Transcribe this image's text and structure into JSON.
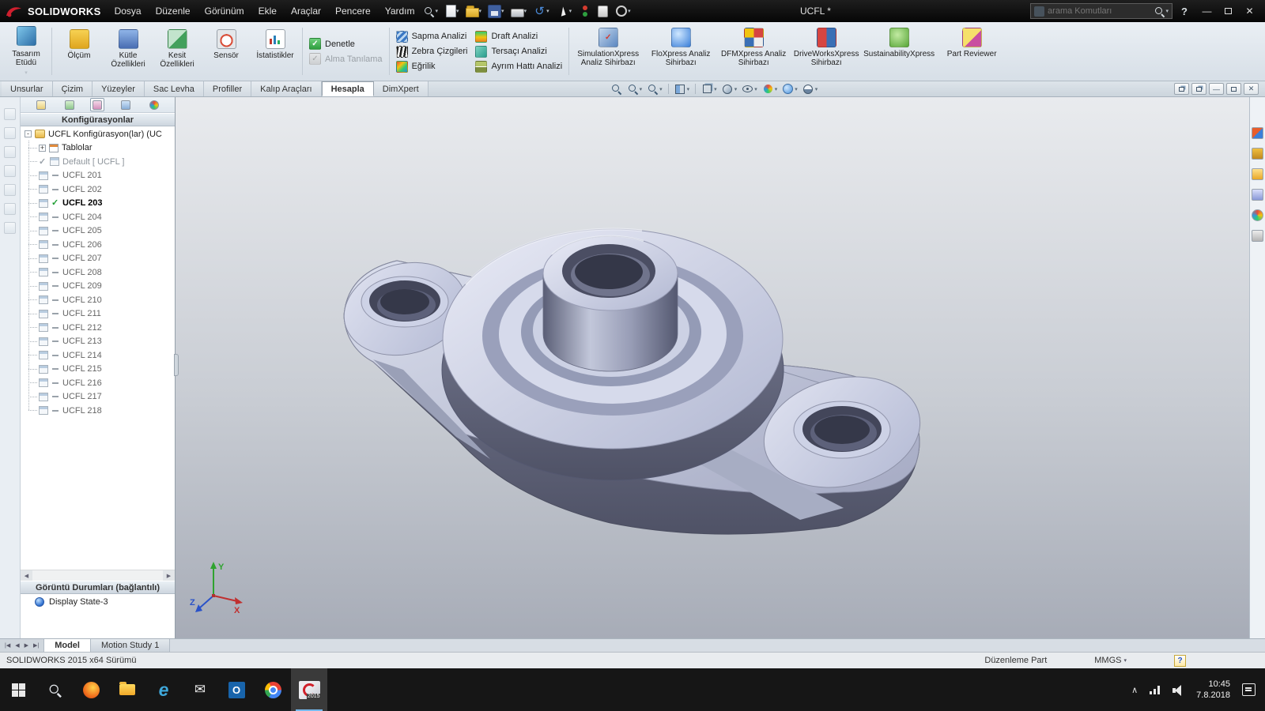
{
  "titlebar": {
    "brand": "SOLIDWORKS",
    "menus": [
      "Dosya",
      "Düzenle",
      "Görünüm",
      "Ekle",
      "Araçlar",
      "Pencere",
      "Yardım"
    ],
    "doc_title": "UCFL *",
    "search_placeholder": "arama Komutları",
    "quick_tools": [
      {
        "name": "new-document",
        "icon": "new-doc-icon",
        "caret": true
      },
      {
        "name": "open",
        "icon": "open-icon",
        "caret": true
      },
      {
        "name": "save",
        "icon": "save-icon",
        "caret": true
      },
      {
        "name": "print",
        "icon": "print-icon",
        "caret": true
      },
      {
        "name": "undo",
        "icon": "undo-icon",
        "caret": true
      },
      {
        "name": "select",
        "icon": "select-icon",
        "caret": true
      },
      {
        "name": "rebuild",
        "icon": "rebuild-icon",
        "caret": false
      },
      {
        "name": "file-properties",
        "icon": "file-properties-icon",
        "caret": false
      },
      {
        "name": "options",
        "icon": "options-icon",
        "caret": true
      }
    ]
  },
  "ribbon": {
    "design_study": {
      "label": "Tasarım Etüdü",
      "icon": "design-study-icon"
    },
    "evaluate_tools": [
      {
        "label": "Ölçüm",
        "icon": "measure-icon"
      },
      {
        "label": "Kütle Özellikleri",
        "icon": "mass-properties-icon"
      },
      {
        "label": "Kesit Özellikleri",
        "icon": "section-properties-icon"
      },
      {
        "label": "Sensör",
        "icon": "sensor-icon"
      },
      {
        "label": "İstatistikler",
        "icon": "statistics-icon"
      }
    ],
    "check_tools": [
      {
        "label": "Denetle",
        "icon": "check-icon",
        "enabled": true
      },
      {
        "label": "Alma Tanılama",
        "icon": "import-diagnostics-icon",
        "enabled": false
      }
    ],
    "analysis_col1": [
      {
        "label": "Sapma Analizi",
        "icon": "deviation-analysis-icon"
      },
      {
        "label": "Zebra Çizgileri",
        "icon": "zebra-stripes-icon"
      },
      {
        "label": "Eğrilik",
        "icon": "curvature-icon"
      }
    ],
    "analysis_col2": [
      {
        "label": "Draft Analizi",
        "icon": "draft-analysis-icon"
      },
      {
        "label": "Tersaçı Analizi",
        "icon": "undercut-analysis-icon"
      },
      {
        "label": "Ayrım Hattı Analizi",
        "icon": "parting-line-analysis-icon"
      }
    ],
    "xpress_tools": [
      {
        "label": "SimulationXpress Analiz Sihirbazı",
        "icon": "simulationxpress-icon"
      },
      {
        "label": "FloXpress Analiz Sihirbazı",
        "icon": "floxpress-icon"
      },
      {
        "label": "DFMXpress Analiz Sihirbazı",
        "icon": "dfmxpress-icon"
      },
      {
        "label": "DriveWorksXpress Sihirbazı",
        "icon": "driveworksxpress-icon"
      },
      {
        "label": "SustainabilityXpress",
        "icon": "sustainabilityxpress-icon"
      },
      {
        "label": "Part Reviewer",
        "icon": "part-reviewer-icon"
      }
    ]
  },
  "command_tabs": {
    "items": [
      "Unsurlar",
      "Çizim",
      "Yüzeyler",
      "Sac Levha",
      "Profiller",
      "Kalıp Araçları",
      "Hesapla",
      "DimXpert"
    ],
    "active": "Hesapla"
  },
  "headsup": [
    {
      "name": "zoom-fit",
      "type": "mag",
      "caret": false
    },
    {
      "name": "zoom-area",
      "type": "mag",
      "caret": true
    },
    {
      "name": "previous-view",
      "type": "mag",
      "caret": true
    },
    {
      "name": "section-view",
      "type": "css",
      "caret": true
    },
    {
      "name": "view-orientation",
      "type": "css",
      "caret": true
    },
    {
      "name": "display-style",
      "type": "css",
      "caret": true
    },
    {
      "name": "hide-show-items",
      "type": "css",
      "caret": true
    },
    {
      "name": "edit-appearance",
      "type": "css",
      "caret": true
    },
    {
      "name": "apply-scene",
      "type": "css",
      "caret": true
    },
    {
      "name": "view-settings",
      "type": "css",
      "caret": true
    }
  ],
  "feature_panel": {
    "header": "Konfigürasyonlar",
    "tree": {
      "root": "UCFL Konfigürasyon(lar)  (UC",
      "tables": "Tablolar",
      "default_config": "Default [ UCFL ]",
      "configs": [
        "UCFL 201",
        "UCFL 202",
        "UCFL 203",
        "UCFL 204",
        "UCFL 205",
        "UCFL 206",
        "UCFL 207",
        "UCFL 208",
        "UCFL 209",
        "UCFL 210",
        "UCFL 211",
        "UCFL 212",
        "UCFL 213",
        "UCFL 214",
        "UCFL 215",
        "UCFL 216",
        "UCFL 217",
        "UCFL 218"
      ],
      "active_config": "UCFL 203"
    },
    "display_header": "Görüntü Durumları (bağlantılı)",
    "display_state": "Display State-3"
  },
  "taskpane_icons": [
    "solidworks-resources",
    "design-library",
    "file-explorer",
    "view-palette",
    "appearances-scenes",
    "custom-properties"
  ],
  "bottom_tabs": {
    "model": "Model",
    "motion_study": "Motion Study 1"
  },
  "statusbar": {
    "left": "SOLIDWORKS 2015 x64 Sürümü",
    "mode": "Düzenleme Part",
    "units": "MMGS"
  },
  "taskbar": {
    "apps": [
      {
        "name": "start"
      },
      {
        "name": "search"
      },
      {
        "name": "firefox"
      },
      {
        "name": "file-explorer"
      },
      {
        "name": "edge"
      },
      {
        "name": "mail"
      },
      {
        "name": "outlook"
      },
      {
        "name": "chrome"
      },
      {
        "name": "solidworks",
        "active": true
      }
    ],
    "sw_badge": "2015",
    "time": "10:45",
    "date": "7.8.2018"
  },
  "colors": {
    "accent_green": "#1e9e32",
    "model_light": "#dfe3f1",
    "model_dark": "#565a70",
    "taskbar_accent": "#76b9ed"
  }
}
